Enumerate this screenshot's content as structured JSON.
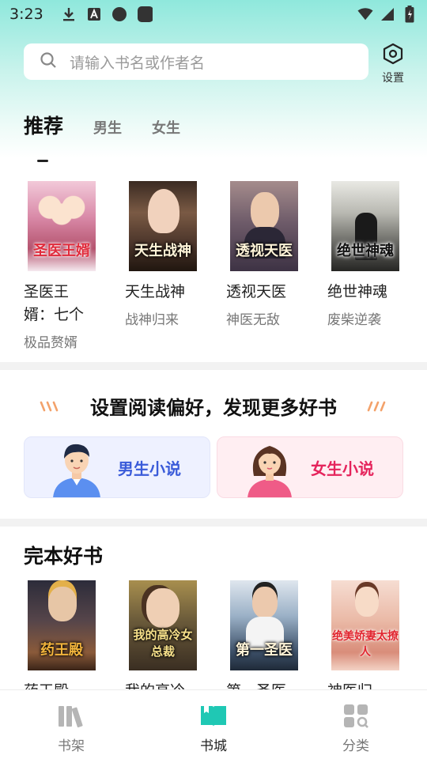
{
  "status_bar": {
    "time": "3:23"
  },
  "search": {
    "placeholder": "请输入书名或作者名"
  },
  "settings": {
    "label": "设置"
  },
  "tabs": [
    {
      "label": "推荐",
      "active": true
    },
    {
      "label": "男生",
      "active": false
    },
    {
      "label": "女生",
      "active": false
    }
  ],
  "recommend_books": [
    {
      "title": "圣医王婿：七个",
      "subtitle": "极品赘婿",
      "cover_text": "圣医王婿"
    },
    {
      "title": "天生战神",
      "subtitle": "战神归来",
      "cover_text": "天生战神"
    },
    {
      "title": "透视天医",
      "subtitle": "神医无敌",
      "cover_text": "透视天医"
    },
    {
      "title": "绝世神魂",
      "subtitle": "废柴逆袭",
      "cover_text": "绝世神魂"
    }
  ],
  "preference": {
    "title": "设置阅读偏好，发现更多好书",
    "male_label": "男生小说",
    "female_label": "女生小说"
  },
  "complete_section": {
    "title": "完本好书",
    "books": [
      {
        "title": "药王殿",
        "cover_text": "药王殿"
      },
      {
        "title": "我的高冷",
        "cover_text": "我的高冷女总裁"
      },
      {
        "title": "第一圣医",
        "cover_text": "第一圣医"
      },
      {
        "title": "神医归",
        "cover_text": "绝美娇妻太撩人"
      }
    ]
  },
  "bottom_nav": [
    {
      "label": "书架",
      "icon": "bookshelf-icon",
      "active": false
    },
    {
      "label": "书城",
      "icon": "bookstore-icon",
      "active": true
    },
    {
      "label": "分类",
      "icon": "category-icon",
      "active": false
    }
  ],
  "colors": {
    "accent": "#1fc8b4",
    "male_card_bg": "#eef1ff",
    "male_text": "#3a5bd9",
    "female_card_bg": "#ffeef2",
    "female_text": "#e5245c"
  }
}
